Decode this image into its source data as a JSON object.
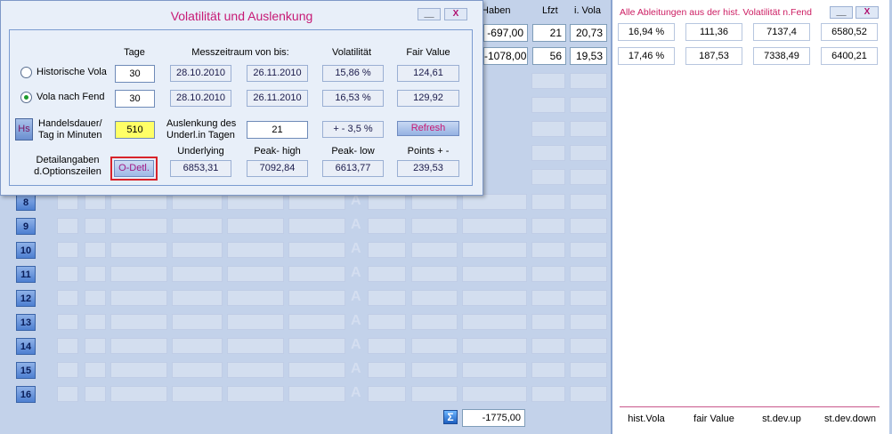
{
  "background": {
    "row_numbers": [
      "8",
      "9",
      "10",
      "11",
      "12",
      "13",
      "14",
      "15",
      "16"
    ],
    "total_value": "-1775,00"
  },
  "top_table": {
    "headers": {
      "haben": "/Haben",
      "lfzt": "Lfzt",
      "vola": "i. Vola"
    },
    "rows": [
      {
        "haben": "-697,00",
        "lfzt": "21",
        "vola": "20,73"
      },
      {
        "haben": "-1078,00",
        "lfzt": "56",
        "vola": "19,53"
      }
    ]
  },
  "right_panel": {
    "title": "Alle Ableitungen aus der hist. Volatilität n.Fend",
    "minimize": "__",
    "close": "X",
    "rows": [
      [
        "16,94 %",
        "111,36",
        "7137,4",
        "6580,52"
      ],
      [
        "17,46 %",
        "187,53",
        "7338,49",
        "6400,21"
      ]
    ],
    "footer": [
      "hist.Vola",
      "fair Value",
      "st.dev.up",
      "st.dev.down"
    ]
  },
  "dialog": {
    "title": "Volatilität und Auslenkung",
    "minimize": "__",
    "close": "X",
    "headers": {
      "tage": "Tage",
      "messzeitraum": "Messzeitraum von bis:",
      "volatilitaet": "Volatilität",
      "fair_value": "Fair Value"
    },
    "rows": [
      {
        "label": "Historische Vola",
        "selected": false,
        "tage": "30",
        "from": "28.10.2010",
        "to": "26.11.2010",
        "vola": "15,86 %",
        "fair": "124,61"
      },
      {
        "label": "Vola nach Fend",
        "selected": true,
        "tage": "30",
        "from": "28.10.2010",
        "to": "26.11.2010",
        "vola": "16,53 %",
        "fair": "129,92"
      }
    ],
    "hs_button": "Hs",
    "handelsdauer_label": "Handelsdauer/\nTag in Minuten",
    "handelsdauer_value": "510",
    "auslenkung_label": "Auslenkung des\nUnderl.in Tagen",
    "auslenkung_value": "21",
    "auslenkung_pct": "+ - 3,5 %",
    "refresh": "Refresh",
    "detail_label": "Detailangaben\nd.Optionszeilen",
    "odetl_button": "O-Detl.",
    "stats_headers": {
      "underlying": "Underlying",
      "peak_high": "Peak- high",
      "peak_low": "Peak- low",
      "points": "Points + -"
    },
    "stats": {
      "underlying": "6853,31",
      "peak_high": "7092,84",
      "peak_low": "6613,77",
      "points": "239,53"
    }
  },
  "colors": {
    "title_magenta": "#c71a75",
    "highlight_yellow": "#ffff66",
    "focus_red": "#d8232a"
  }
}
